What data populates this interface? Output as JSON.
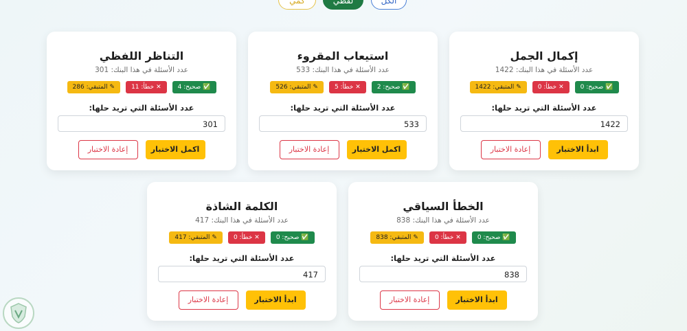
{
  "filters": {
    "all": "الكل",
    "verbal": "لفظي",
    "quant": "كمي"
  },
  "colors": {
    "correct": "#1f8a4c",
    "wrong": "#dc3545",
    "remaining": "#f5b912",
    "primary": "#ffc107"
  },
  "icons": {
    "correct": "check-icon",
    "wrong": "x-icon",
    "remaining": "pencil-icon"
  },
  "cards": [
    {
      "title": "إكمال الجمل",
      "bank": "عدد الأسئلة في هذا البنك: 1422",
      "correct": "صحيح: 0",
      "wrong": "خطأ: 0",
      "remaining": "المتبقي: 1422",
      "prompt": "عدد الأسئلة التي تريد حلها:",
      "value": "1422",
      "primary": "ابدأ الاختبار",
      "reset": "إعادة الاختبار"
    },
    {
      "title": "استيعاب المقروء",
      "bank": "عدد الأسئلة في هذا البنك: 533",
      "correct": "صحيح: 2",
      "wrong": "خطأ: 5",
      "remaining": "المتبقي: 526",
      "prompt": "عدد الأسئلة التي تريد حلها:",
      "value": "533",
      "primary": "اكمل الاختبار",
      "reset": "إعادة الاختبار"
    },
    {
      "title": "التناظر اللفظي",
      "bank": "عدد الأسئلة في هذا البنك: 301",
      "correct": "صحيح: 4",
      "wrong": "خطأ: 11",
      "remaining": "المتبقي: 286",
      "prompt": "عدد الأسئلة التي تريد حلها:",
      "value": "301",
      "primary": "اكمل الاختبار",
      "reset": "إعادة الاختبار"
    },
    {
      "title": "الخطأ السياقي",
      "bank": "عدد الأسئلة في هذا البنك: 838",
      "correct": "صحيح: 0",
      "wrong": "خطأ: 0",
      "remaining": "المتبقي: 838",
      "prompt": "عدد الأسئلة التي تريد حلها:",
      "value": "838",
      "primary": "ابدأ الاختبار",
      "reset": "إعادة الاختبار"
    },
    {
      "title": "الكلمة الشاذة",
      "bank": "عدد الأسئلة في هذا البنك: 417",
      "correct": "صحيح: 0",
      "wrong": "خطأ: 0",
      "remaining": "المتبقي: 417",
      "prompt": "عدد الأسئلة التي تريد حلها:",
      "value": "417",
      "primary": "ابدأ الاختبار",
      "reset": "إعادة الاختبار"
    }
  ]
}
